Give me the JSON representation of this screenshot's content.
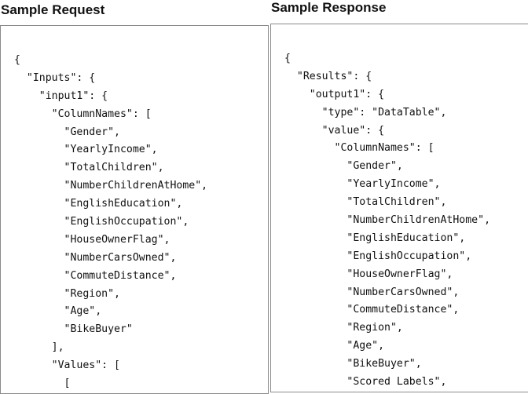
{
  "request": {
    "title": "Sample Request",
    "lines": [
      "{",
      "  \"Inputs\": {",
      "    \"input1\": {",
      "      \"ColumnNames\": [",
      "        \"Gender\",",
      "        \"YearlyIncome\",",
      "        \"TotalChildren\",",
      "        \"NumberChildrenAtHome\",",
      "        \"EnglishEducation\",",
      "        \"EnglishOccupation\",",
      "        \"HouseOwnerFlag\",",
      "        \"NumberCarsOwned\",",
      "        \"CommuteDistance\",",
      "        \"Region\",",
      "        \"Age\",",
      "        \"BikeBuyer\"",
      "      ],",
      "      \"Values\": [",
      "        ["
    ]
  },
  "response": {
    "title": "Sample Response",
    "lines": [
      "{",
      "  \"Results\": {",
      "    \"output1\": {",
      "      \"type\": \"DataTable\",",
      "      \"value\": {",
      "        \"ColumnNames\": [",
      "          \"Gender\",",
      "          \"YearlyIncome\",",
      "          \"TotalChildren\",",
      "          \"NumberChildrenAtHome\",",
      "          \"EnglishEducation\",",
      "          \"EnglishOccupation\",",
      "          \"HouseOwnerFlag\",",
      "          \"NumberCarsOwned\",",
      "          \"CommuteDistance\",",
      "          \"Region\",",
      "          \"Age\",",
      "          \"BikeBuyer\",",
      "          \"Scored Labels\","
    ]
  }
}
